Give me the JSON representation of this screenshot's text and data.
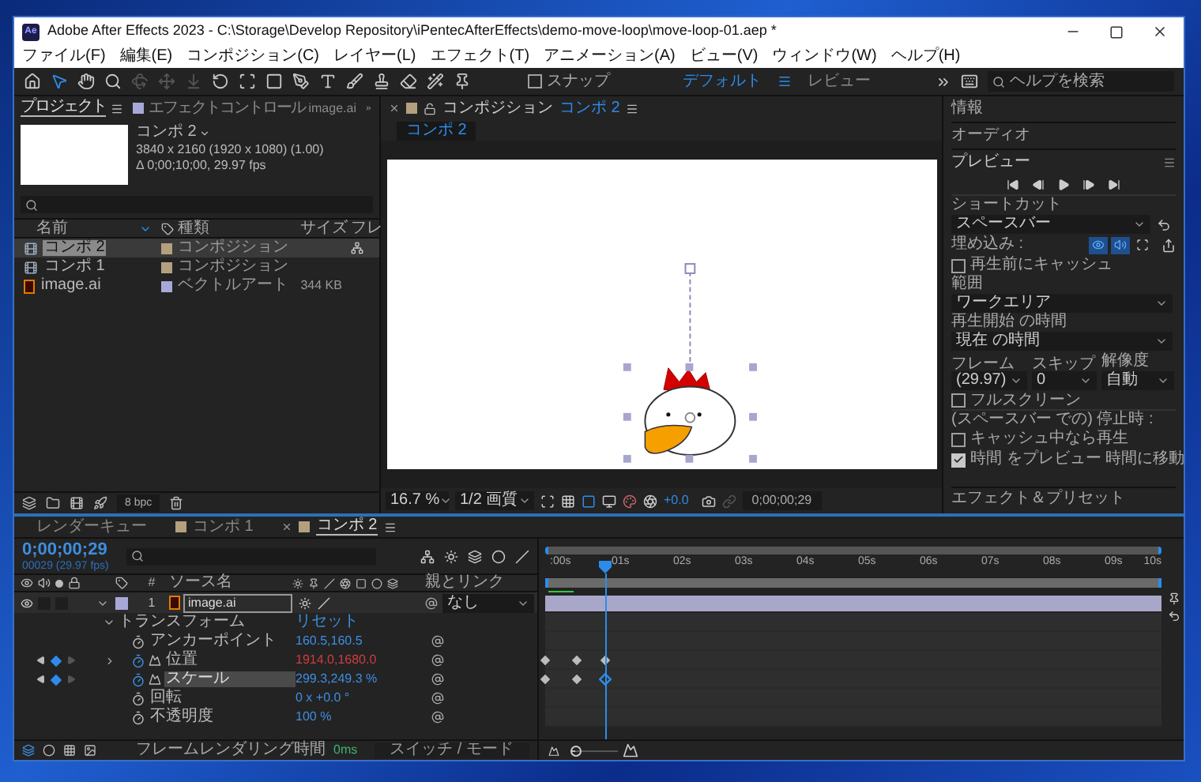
{
  "window": {
    "title": "Adobe After Effects 2023 - C:\\Storage\\Develop Repository\\iPentecAfterEffects\\demo-move-loop\\move-loop-01.aep *",
    "app_badge": "Ae"
  },
  "menu": [
    "ファイル(F)",
    "編集(E)",
    "コンポジション(C)",
    "レイヤー(L)",
    "エフェクト(T)",
    "アニメーション(A)",
    "ビュー(V)",
    "ウィンドウ(W)",
    "ヘルプ(H)"
  ],
  "toolbar": {
    "tools": [
      {
        "selected": false,
        "disabled": false
      },
      {
        "selected": true,
        "disabled": false
      },
      {
        "selected": false,
        "disabled": false
      },
      {
        "selected": false,
        "disabled": false
      },
      {
        "selected": false,
        "disabled": true
      },
      {
        "selected": false,
        "disabled": true
      },
      {
        "selected": false,
        "disabled": true
      },
      {
        "selected": false,
        "disabled": false
      },
      {
        "selected": false,
        "disabled": false
      },
      {
        "selected": false,
        "disabled": false
      },
      {
        "selected": false,
        "disabled": false
      },
      {
        "selected": false,
        "disabled": false
      },
      {
        "selected": false,
        "disabled": false
      },
      {
        "selected": false,
        "disabled": false
      },
      {
        "selected": false,
        "disabled": false
      },
      {
        "selected": false,
        "disabled": false
      },
      {
        "selected": false,
        "disabled": false
      }
    ],
    "snap": {
      "label": "スナップ",
      "checked": false
    },
    "workspaces": [
      {
        "label": "デフォルト",
        "selected": true
      },
      {
        "label": "レビュー",
        "selected": false
      }
    ],
    "search": {
      "placeholder": "ヘルプを検索"
    }
  },
  "project": {
    "tabs": [
      {
        "label": "プロジェクト",
        "selected": true
      },
      {
        "label": "エフェクトコントロール",
        "suffix": "image.ai",
        "selected": false
      }
    ],
    "preview": {
      "name": "コンポ 2",
      "details": [
        "3840 x 2160  (1920 x 1080) (1.00)",
        "Δ 0;00;10;00, 29.97 fps"
      ]
    },
    "columns": [
      "名前",
      "種類",
      "サイズ",
      "フレ"
    ],
    "items": [
      {
        "name": "コンポ 2",
        "type": "コンポジション",
        "kind": "composition",
        "color": "#b4a07e",
        "selected": true
      },
      {
        "name": "コンポ 1",
        "type": "コンポジション",
        "kind": "composition",
        "color": "#b4a07e",
        "selected": false
      },
      {
        "name": "image.ai",
        "type": "ベクトルアート",
        "size": "344 KB",
        "kind": "file",
        "color": "#a8a8d8",
        "selected": false
      }
    ],
    "bit_depth": "8 bpc"
  },
  "composition": {
    "title": "コンポジション",
    "name": "コンポ 2",
    "color": "#b4a07e",
    "view_tab": "コンポ 2",
    "zoom": "16.7 %",
    "resolution": "1/2 画質",
    "exposure": "+0.0",
    "timecode": "0;00;00;29"
  },
  "side": {
    "sections": [
      "情報",
      "オーディオ"
    ],
    "preview": {
      "title": "プレビュー",
      "shortcut_label": "ショートカット",
      "shortcut": "スペースバー",
      "embed_label": "埋め込み :",
      "embed": [
        {
          "on": true
        },
        {
          "on": true
        },
        {
          "on": false
        }
      ],
      "cache": {
        "label": "再生前にキャッシュ",
        "checked": false
      },
      "range_label": "範囲",
      "range": "ワークエリア",
      "start_label": "再生開始 の時間",
      "start": "現在 の時間",
      "frame_label": "フレーム",
      "skip_label": "スキップ",
      "resolution_label": "解像度",
      "frame": "(29.97)",
      "skip": "0",
      "resolution": "自動",
      "fullscreen": {
        "label": "フルスクリーン",
        "checked": false
      },
      "stop_label": "(スペースバー での) 停止時 :",
      "stop_options": [
        {
          "label": "キャッシュ中なら再生",
          "checked": false
        },
        {
          "label": "時間 をプレビュー 時間に移動",
          "checked": true
        }
      ]
    },
    "effects": "エフェクト＆プリセット"
  },
  "timeline": {
    "tabs": [
      {
        "label": "レンダーキュー",
        "kind": "queue",
        "selected": false
      },
      {
        "label": "コンポ 1",
        "kind": "composition",
        "color": "#b4a07e",
        "selected": false
      },
      {
        "label": "コンポ 2",
        "kind": "composition",
        "color": "#b4a07e",
        "selected": true
      }
    ],
    "timecode": "0;00;00;29",
    "frames": "00029 (29.97 fps)",
    "columns": {
      "number": "#",
      "name": "ソース名",
      "parent": "親とリンク"
    },
    "layer": {
      "number": "1",
      "name": "image.ai",
      "color": "#a8a8d8",
      "visible": true,
      "expanded": true,
      "parent": "なし"
    },
    "transform": {
      "label": "トランスフォーム",
      "reset": "リセット",
      "expanded": true
    },
    "properties": [
      {
        "name": "アンカーポイント",
        "value": "160.5,160.5",
        "color": "#3d8ee0",
        "animated": false,
        "selected": false
      },
      {
        "name": "位置",
        "value": "1914.0,1680.0",
        "color": "#d23c3c",
        "animated": true,
        "expanded": false,
        "at_keyframe": true,
        "selected": false,
        "keyframes": [
          {
            "level": 0,
            "selected": false
          },
          {
            "level": 0.05,
            "selected": false
          },
          {
            "level": 0.097,
            "selected": false
          }
        ]
      },
      {
        "name": "スケール",
        "value": "299.3,249.3 %",
        "color": "#3d8ee0",
        "animated": true,
        "at_keyframe": true,
        "selected": true,
        "keyframes": [
          {
            "level": 0,
            "selected": false
          },
          {
            "level": 0.05,
            "selected": false
          },
          {
            "level": 0.097,
            "selected": true
          }
        ]
      },
      {
        "name": "回転",
        "value": "0 x +0.0 °",
        "color": "#3d8ee0",
        "animated": false,
        "selected": false
      },
      {
        "name": "不透明度",
        "value": "100 %",
        "color": "#3d8ee0",
        "animated": false,
        "selected": false
      }
    ],
    "ruler": [
      ":00s",
      "01s",
      "02s",
      "03s",
      "04s",
      "05s",
      "06s",
      "07s",
      "08s",
      "09s",
      "10s"
    ],
    "playhead": {
      "level": 0.097
    },
    "zoom_slider": {
      "level": 0.1
    },
    "render_label": "フレームレンダリング時間",
    "render_time": "0ms",
    "mode_toggle": "スイッチ / モード"
  }
}
